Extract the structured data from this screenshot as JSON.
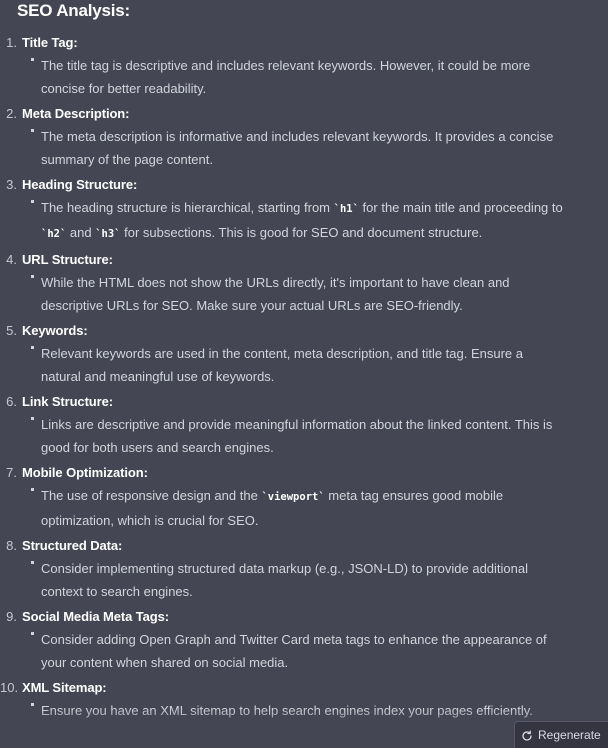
{
  "analysis": {
    "heading": "SEO Analysis:",
    "items": [
      {
        "number": "1.",
        "title": "Title Tag:",
        "segments": [
          {
            "text": "The title tag is descriptive and includes relevant keywords. However, it could be more concise for better readability."
          }
        ]
      },
      {
        "number": "2.",
        "title": "Meta Description:",
        "segments": [
          {
            "text": "The meta description is informative and includes relevant keywords. It provides a concise summary of the page content."
          }
        ]
      },
      {
        "number": "3.",
        "title": "Heading Structure:",
        "segments": [
          {
            "text": "The heading structure is hierarchical, starting from "
          },
          {
            "code": "`h1`"
          },
          {
            "text": " for the main title and proceeding to "
          },
          {
            "code": "`h2`"
          },
          {
            "text": " and "
          },
          {
            "code": "`h3`"
          },
          {
            "text": " for subsections. This is good for SEO and document structure."
          }
        ]
      },
      {
        "number": "4.",
        "title": "URL Structure:",
        "segments": [
          {
            "text": "While the HTML does not show the URLs directly, it's important to have clean and descriptive URLs for SEO. Make sure your actual URLs are SEO-friendly."
          }
        ]
      },
      {
        "number": "5.",
        "title": "Keywords:",
        "segments": [
          {
            "text": "Relevant keywords are used in the content, meta description, and title tag. Ensure a natural and meaningful use of keywords."
          }
        ]
      },
      {
        "number": "6.",
        "title": "Link Structure:",
        "segments": [
          {
            "text": "Links are descriptive and provide meaningful information about the linked content. This is good for both users and search engines."
          }
        ]
      },
      {
        "number": "7.",
        "title": "Mobile Optimization:",
        "segments": [
          {
            "text": "The use of responsive design and the "
          },
          {
            "code": "`viewport`"
          },
          {
            "text": " meta tag ensures good mobile optimization, which is crucial for SEO."
          }
        ]
      },
      {
        "number": "8.",
        "title": "Structured Data:",
        "segments": [
          {
            "text": "Consider implementing structured data markup (e.g., JSON-LD) to provide additional context to search engines."
          }
        ]
      },
      {
        "number": "9.",
        "title": "Social Media Meta Tags:",
        "segments": [
          {
            "text": "Consider adding Open Graph and Twitter Card meta tags to enhance the appearance of your content when shared on social media."
          }
        ]
      },
      {
        "number": "10.",
        "title": "XML Sitemap:",
        "segments": [
          {
            "text": "Ensure you have an XML sitemap to help search engines index your pages efficiently."
          }
        ]
      }
    ]
  },
  "regenerate": {
    "icon": "refresh-icon",
    "label": "Regenerate"
  }
}
